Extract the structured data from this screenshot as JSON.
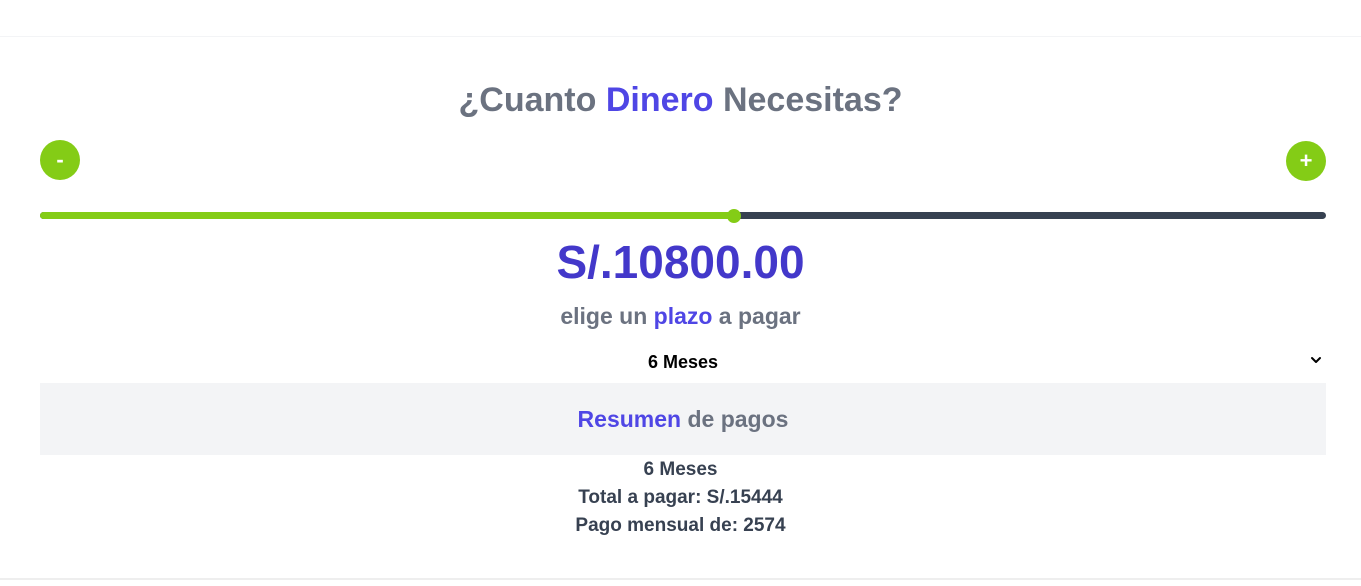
{
  "title": {
    "part1": "¿Cuanto ",
    "accent": "Dinero",
    "part2": " Necesitas?"
  },
  "buttons": {
    "minus_label": "-",
    "plus_label": "+"
  },
  "slider": {
    "fraction": 0.54
  },
  "amount": "S/.10800.00",
  "term_prompt": {
    "part1": "elige un ",
    "accent": "plazo",
    "part2": " a pagar"
  },
  "term_select": {
    "selected": "6 Meses"
  },
  "summary": {
    "title_accent": "Resumen",
    "title_rest": " de pagos",
    "months": "6 Meses",
    "total": "Total a pagar: S/.15444",
    "monthly": "Pago mensual de: 2574"
  },
  "colors": {
    "accent": "#4f46e5",
    "green": "#84cc16",
    "gray_text": "#6b7280",
    "track": "#374151"
  }
}
